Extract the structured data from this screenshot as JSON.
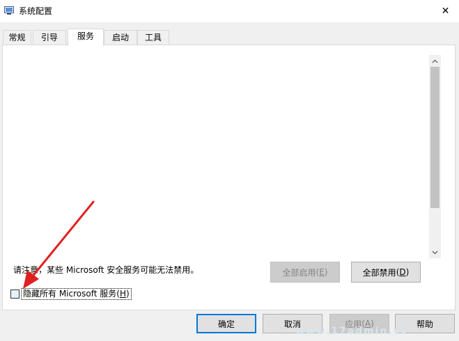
{
  "window": {
    "title": "系统配置",
    "close_glyph": "✕"
  },
  "tabs": [
    {
      "label": "常规",
      "active": false
    },
    {
      "label": "引导",
      "active": false
    },
    {
      "label": "服务",
      "active": true
    },
    {
      "label": "启动",
      "active": false
    },
    {
      "label": "工具",
      "active": false
    }
  ],
  "services_tab": {
    "note": "请注意，某些 Microsoft 安全服务可能无法禁用。",
    "enable_all": {
      "label": "全部启用",
      "shortcut": "E"
    },
    "disable_all": {
      "label": "全部禁用",
      "shortcut": "D"
    },
    "hide_ms": {
      "label": "隐藏所有 Microsoft 服务",
      "shortcut": "H",
      "checked": false
    }
  },
  "footer": {
    "ok": {
      "label": "确定"
    },
    "cancel": {
      "label": "取消"
    },
    "apply": {
      "label": "应用",
      "shortcut": "A"
    },
    "help": {
      "label": "帮助"
    }
  },
  "watermark": "www.17admin.cc",
  "colors": {
    "annotation_arrow": "#e02020",
    "default_button_border": "#0078d7"
  }
}
